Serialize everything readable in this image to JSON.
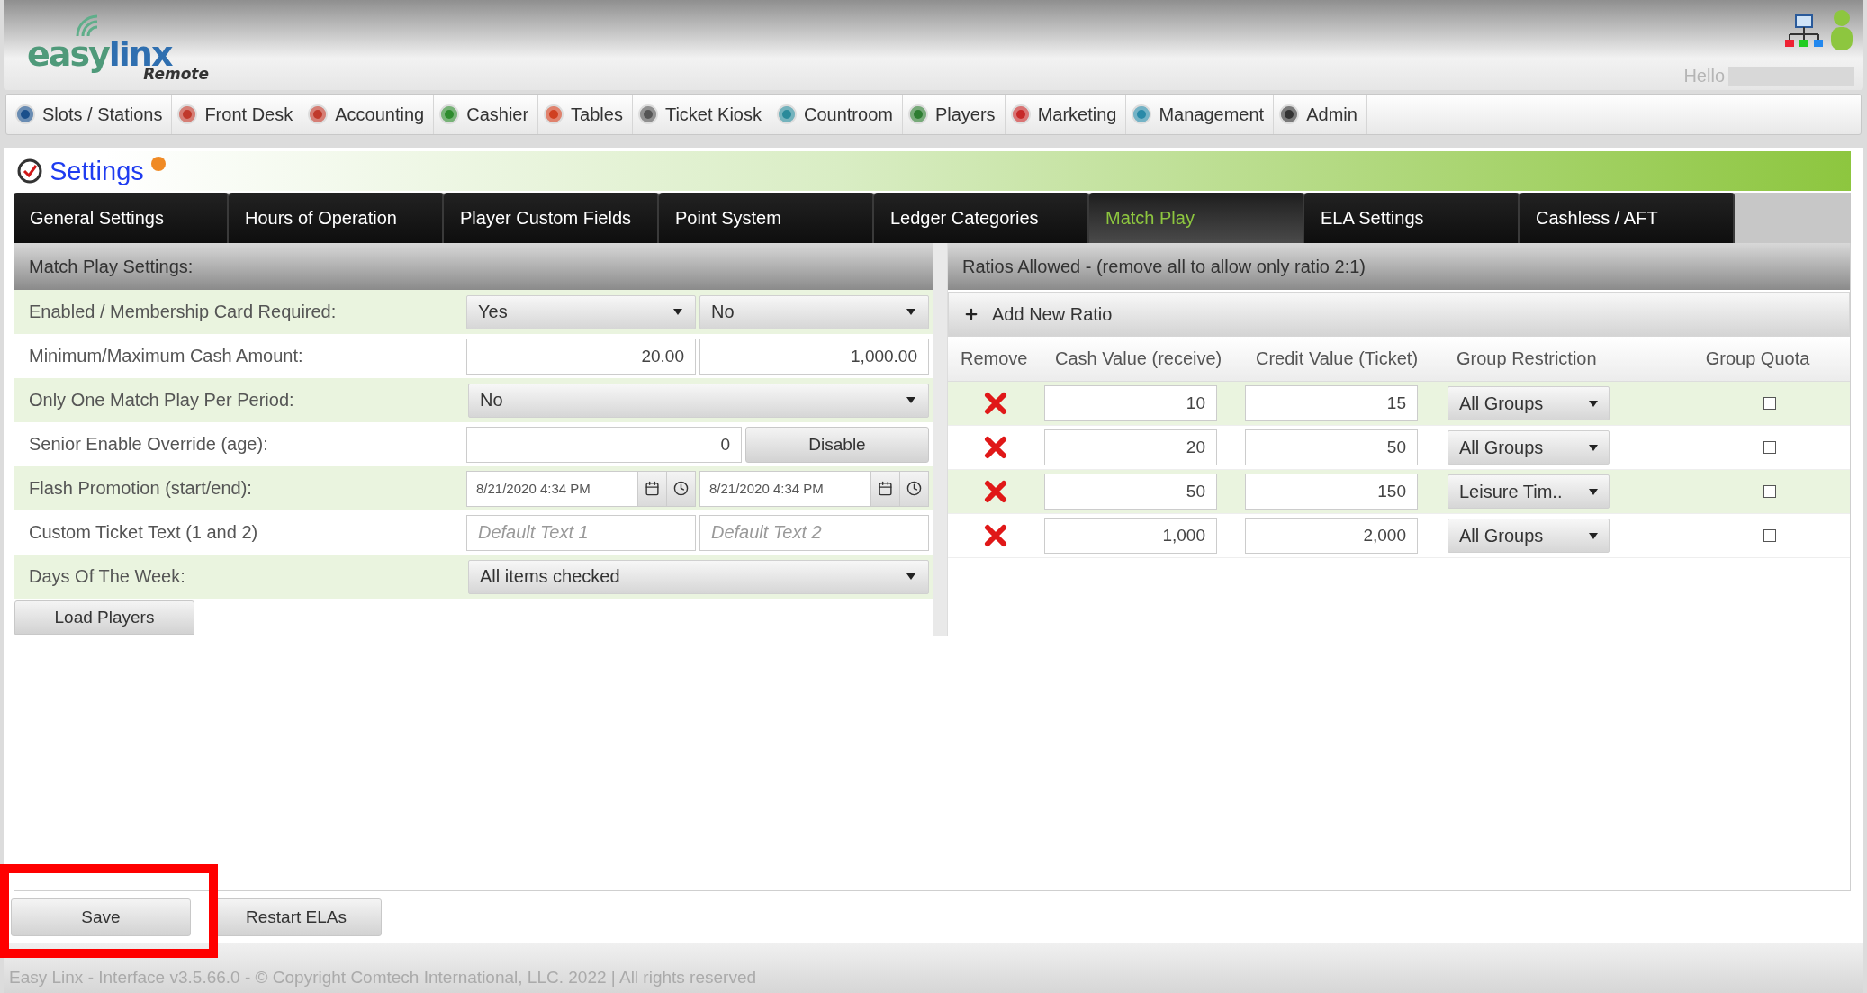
{
  "header": {
    "logo": {
      "parts": [
        "easy",
        "linx"
      ],
      "tagline": "Remote"
    },
    "greeting": "Hello"
  },
  "nav": [
    {
      "label": "Slots / Stations"
    },
    {
      "label": "Front Desk"
    },
    {
      "label": "Accounting"
    },
    {
      "label": "Cashier"
    },
    {
      "label": "Tables"
    },
    {
      "label": "Ticket Kiosk"
    },
    {
      "label": "Countroom"
    },
    {
      "label": "Players"
    },
    {
      "label": "Marketing"
    },
    {
      "label": "Management"
    },
    {
      "label": "Admin"
    }
  ],
  "page_title": "Settings",
  "tabs": [
    {
      "label": "General Settings",
      "selected": false
    },
    {
      "label": "Hours of Operation",
      "selected": false
    },
    {
      "label": "Player Custom Fields",
      "selected": false
    },
    {
      "label": "Point System",
      "selected": false
    },
    {
      "label": "Ledger Categories",
      "selected": false
    },
    {
      "label": "Match Play",
      "selected": true
    },
    {
      "label": "ELA Settings",
      "selected": false
    },
    {
      "label": "Cashless / AFT",
      "selected": false
    }
  ],
  "match_play_settings": {
    "title": "Match Play Settings:",
    "rows": [
      {
        "label": "Enabled / Membership Card Required:",
        "kind": "selects",
        "values": [
          "Yes",
          "No"
        ]
      },
      {
        "label": "Minimum/Maximum Cash Amount:",
        "kind": "inputs",
        "values": [
          "20.00",
          "1,000.00"
        ]
      },
      {
        "label": "Only One Match Play Per Period:",
        "kind": "select",
        "values": [
          "No"
        ]
      },
      {
        "label": "Senior Enable Override (age):",
        "kind": "input_button",
        "values": [
          "0"
        ],
        "button": "Disable"
      },
      {
        "label": "Flash Promotion (start/end):",
        "kind": "datetimes",
        "values": [
          "8/21/2020 4:34 PM",
          "8/21/2020 4:34 PM"
        ]
      },
      {
        "label": "Custom Ticket Text (1 and 2)",
        "kind": "placeholders",
        "values": [
          "Default Text 1",
          "Default Text 2"
        ]
      },
      {
        "label": "Days Of The Week:",
        "kind": "select",
        "values": [
          "All items checked"
        ]
      }
    ],
    "load_button": "Load Players"
  },
  "ratios": {
    "title": "Ratios Allowed - (remove all to allow only ratio 2:1)",
    "add_button": "Add New Ratio",
    "columns": [
      "Remove",
      "Cash Value (receive)",
      "Credit Value (Ticket)",
      "Group Restriction",
      "Group Quota"
    ],
    "rows": [
      {
        "cash": "10",
        "credit": "15",
        "group": "All Groups",
        "quota": false
      },
      {
        "cash": "20",
        "credit": "50",
        "group": "All Groups",
        "quota": false
      },
      {
        "cash": "50",
        "credit": "150",
        "group": "Leisure Tim..",
        "quota": false
      },
      {
        "cash": "1,000",
        "credit": "2,000",
        "group": "All Groups",
        "quota": false
      }
    ]
  },
  "buttons": [
    {
      "label": "Save",
      "highlighted": true
    },
    {
      "label": "Restart ELAs",
      "highlighted": false
    }
  ],
  "footer": "Easy Linx - Interface v3.5.66.0 - © Copyright Comtech International, LLC. 2022 | All rights reserved"
}
